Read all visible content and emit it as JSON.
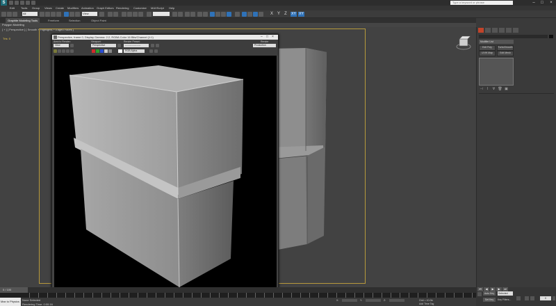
{
  "title_bar": {
    "app_logo": "S",
    "search_placeholder": "Type a keyword or phrase",
    "minimize": "–",
    "maximize": "□",
    "close": "×"
  },
  "menu": [
    "Edit",
    "Tools",
    "Group",
    "Views",
    "Create",
    "Modifiers",
    "Animation",
    "Graph Editors",
    "Rendering",
    "Customize",
    "MAXScript",
    "Help"
  ],
  "toolbar": {
    "selection_filter": "All",
    "view_dropdown": "View",
    "axis_labels": [
      "X",
      "Y",
      "Z",
      "XY",
      "XY"
    ]
  },
  "ribbon": {
    "tabs": [
      "Graphite Modeling Tools",
      "Freeform",
      "Selection",
      "Object Paint"
    ],
    "active_tab": "Graphite Modeling Tools",
    "sub_label": "Polygon Modeling"
  },
  "viewport": {
    "label": "[ + ] [ Perspective ] [ Smooth + Highlights + Edged Faces ]",
    "stat": "Tris:      0"
  },
  "render_window": {
    "title": "Perspective, frame 0, Display Gamma: 2.2, RGBA Color 16 Bits/Channel (1:1)",
    "area_to_render_label": "Area to Render:",
    "area_to_render_value": "View",
    "viewport_label": "Viewport:",
    "viewport_value": "Perspective",
    "render_preset_label": "Render Preset:",
    "render_preset_value": "-------------------",
    "render_button": "Render",
    "production_value": "Production",
    "channel_value": "RGB Alpha"
  },
  "command_panel": {
    "modifier_list": "Modifier List",
    "buttons": [
      "Edit Poly",
      "TurboSmooth",
      "UVW Map",
      "Edit Mesh"
    ]
  },
  "timeline": {
    "slider": "0 / 100"
  },
  "status": {
    "maxscript": "Max to Physics",
    "line1": "None Selected",
    "line2": "Rendering Time: 0:00:16",
    "x_label": "X:",
    "y_label": "Y:",
    "z_label": "Z:",
    "grid": "Grid = 10.0in",
    "add_time_tag": "Add Time Tag",
    "auto_key": "Auto Key",
    "selected": "Selected",
    "set_key": "Set Key",
    "key_filters": "Key Filters...",
    "frame": "0"
  }
}
